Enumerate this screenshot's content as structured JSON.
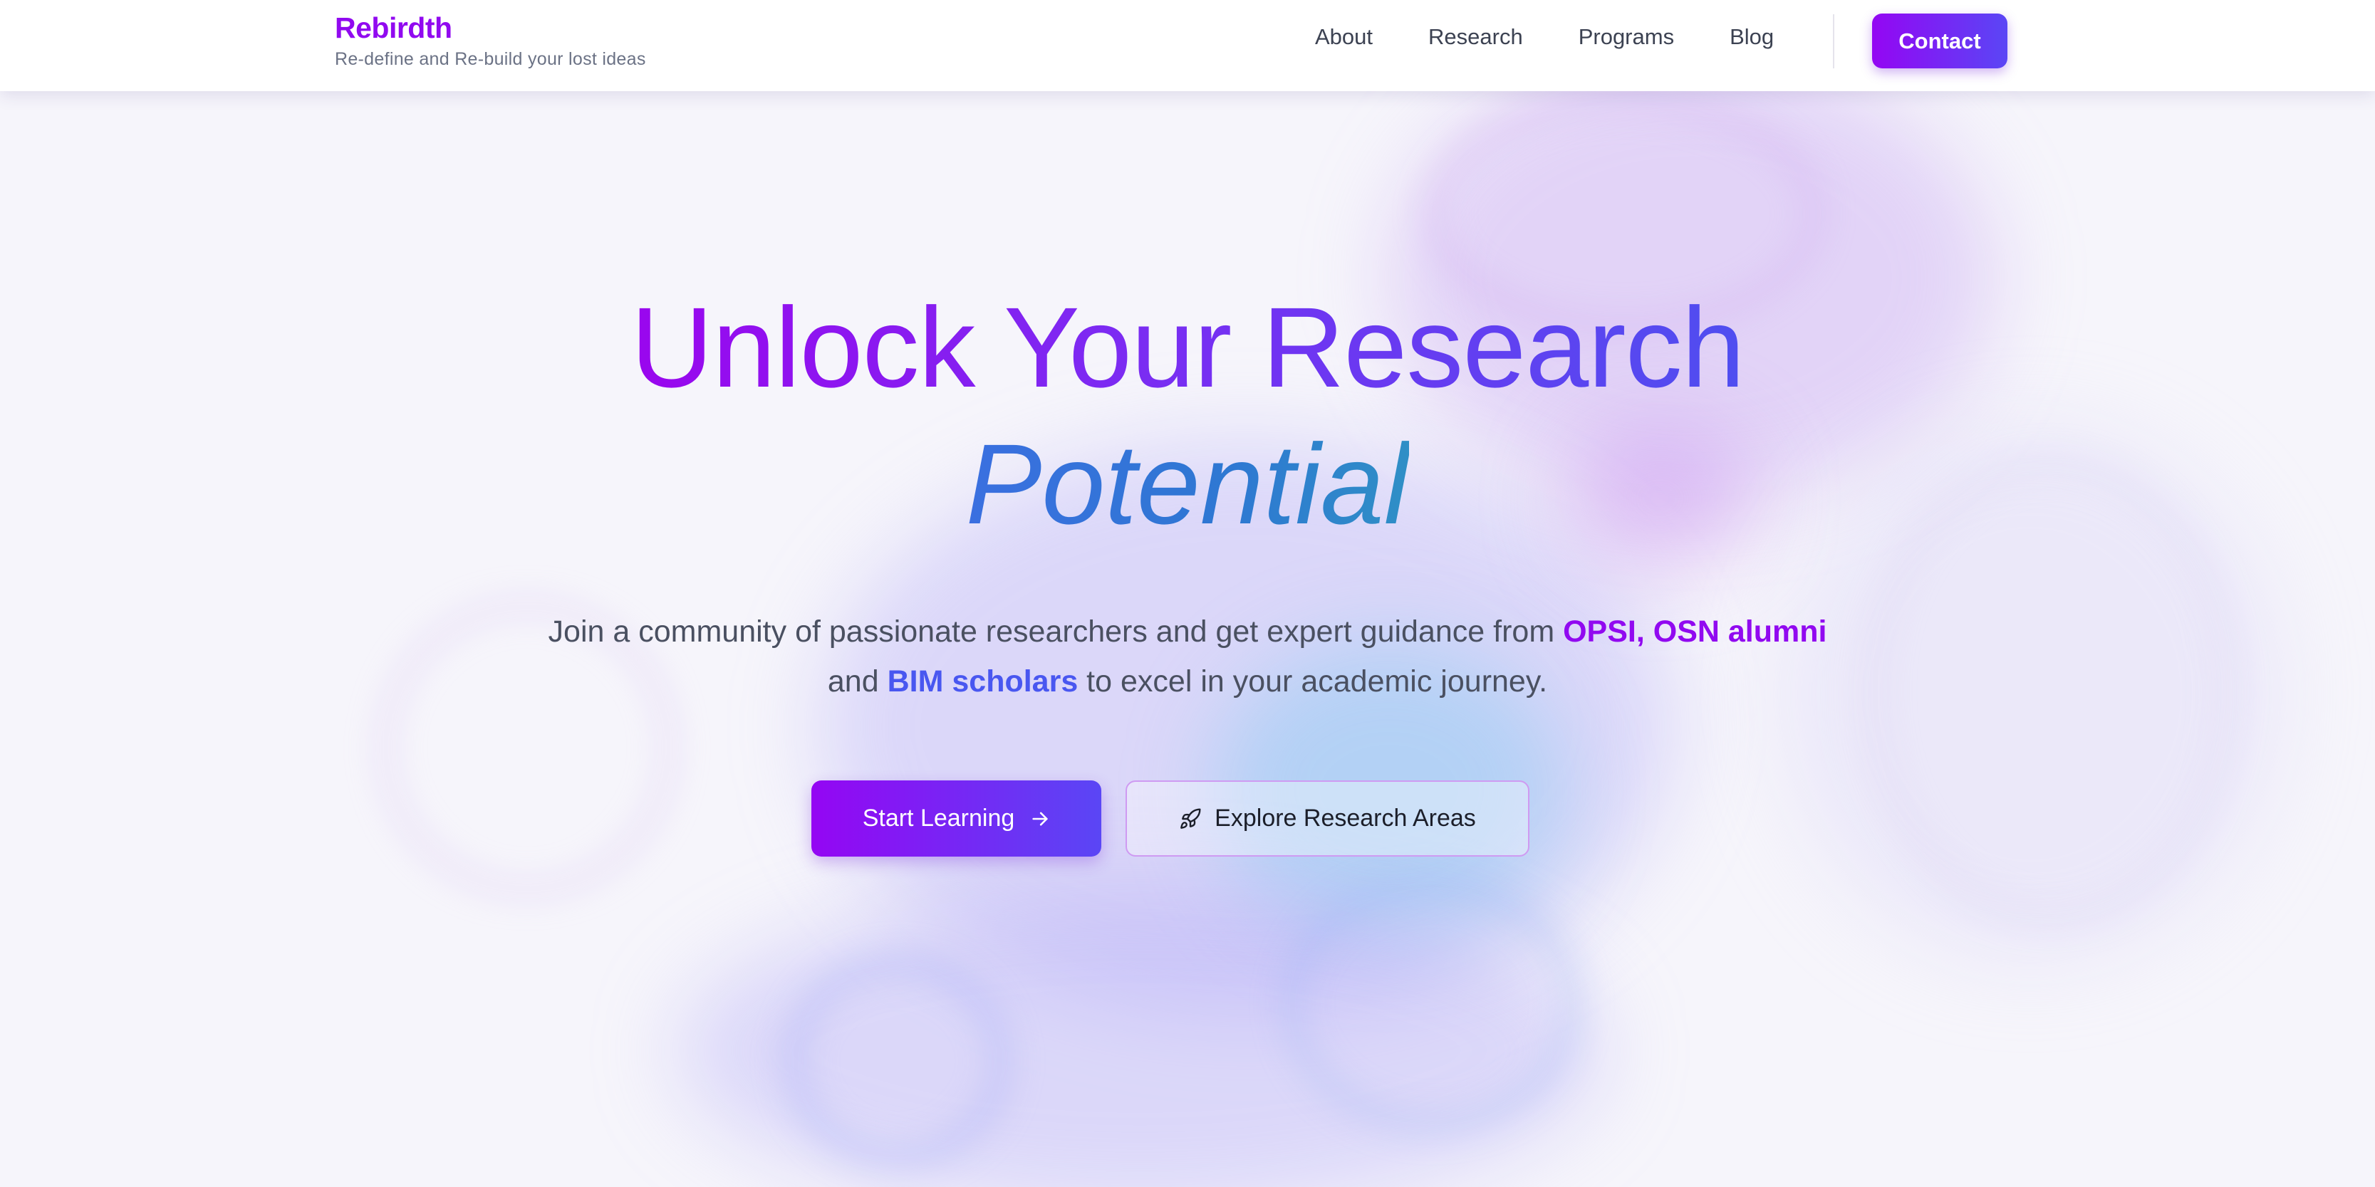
{
  "brand": {
    "name": "Rebirdth",
    "tagline": "Re-define and Re-build your lost ideas"
  },
  "nav": {
    "items": [
      {
        "label": "About"
      },
      {
        "label": "Research"
      },
      {
        "label": "Programs"
      },
      {
        "label": "Blog"
      }
    ],
    "contact_label": "Contact"
  },
  "hero": {
    "headline_line1": "Unlock Your Research",
    "headline_line2": "Potential",
    "subtitle": {
      "part1": "Join a community of passionate researchers and get expert guidance from ",
      "highlight1": "OPSI, OSN alumni",
      "part2": " and ",
      "highlight2": "BIM scholars",
      "part3": " to excel in your academic journey."
    },
    "primary_button": {
      "label": "Start Learning",
      "icon": "arrow-right-icon"
    },
    "secondary_button": {
      "label": "Explore Research Areas",
      "icon": "rocket-icon"
    }
  },
  "colors": {
    "brand_purple": "#9109f0",
    "brand_blue": "#4957f0",
    "gradient_start": "#9406f3",
    "gradient_end": "#5a46f5",
    "potential_blue": "#2e78d2",
    "text_body": "#4a5061"
  }
}
